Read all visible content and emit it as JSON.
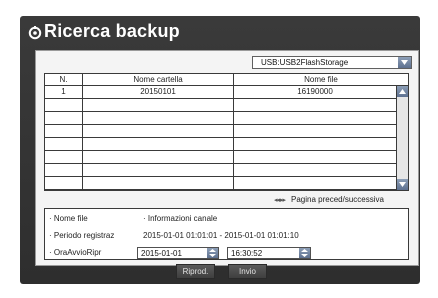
{
  "dialog": {
    "title": "Ricerca backup"
  },
  "storage": {
    "selected": "USB:USB2FlashStorage"
  },
  "table": {
    "headers": [
      "N.",
      "Nome cartella",
      "Nome file"
    ],
    "rows": [
      [
        "1",
        "20150101",
        "16190000"
      ],
      [
        "",
        "",
        ""
      ],
      [
        "",
        "",
        ""
      ],
      [
        "",
        "",
        ""
      ],
      [
        "",
        "",
        ""
      ],
      [
        "",
        "",
        ""
      ],
      [
        "",
        "",
        ""
      ],
      [
        "",
        "",
        ""
      ]
    ]
  },
  "pager": {
    "arrows": "◂◂ ▸▸",
    "label": "Pagina preced/successiva"
  },
  "info": {
    "file_name_label": "· Nome file",
    "channel_info_label": "· Informazioni canale",
    "period_label": "· Periodo registraz",
    "period_value": "2015-01-01 01:01:01 - 2015-01-01 01:01:10",
    "start_time_label": "· OraAvvioRipr",
    "start_date": "2015-01-01",
    "start_time": "16:30:52"
  },
  "buttons": {
    "play": "Riprod.",
    "send": "Invio"
  },
  "colors": {
    "window_bg": "#333333",
    "content_bg": "#f4f4f4",
    "arrow_button": "#6f829f"
  }
}
